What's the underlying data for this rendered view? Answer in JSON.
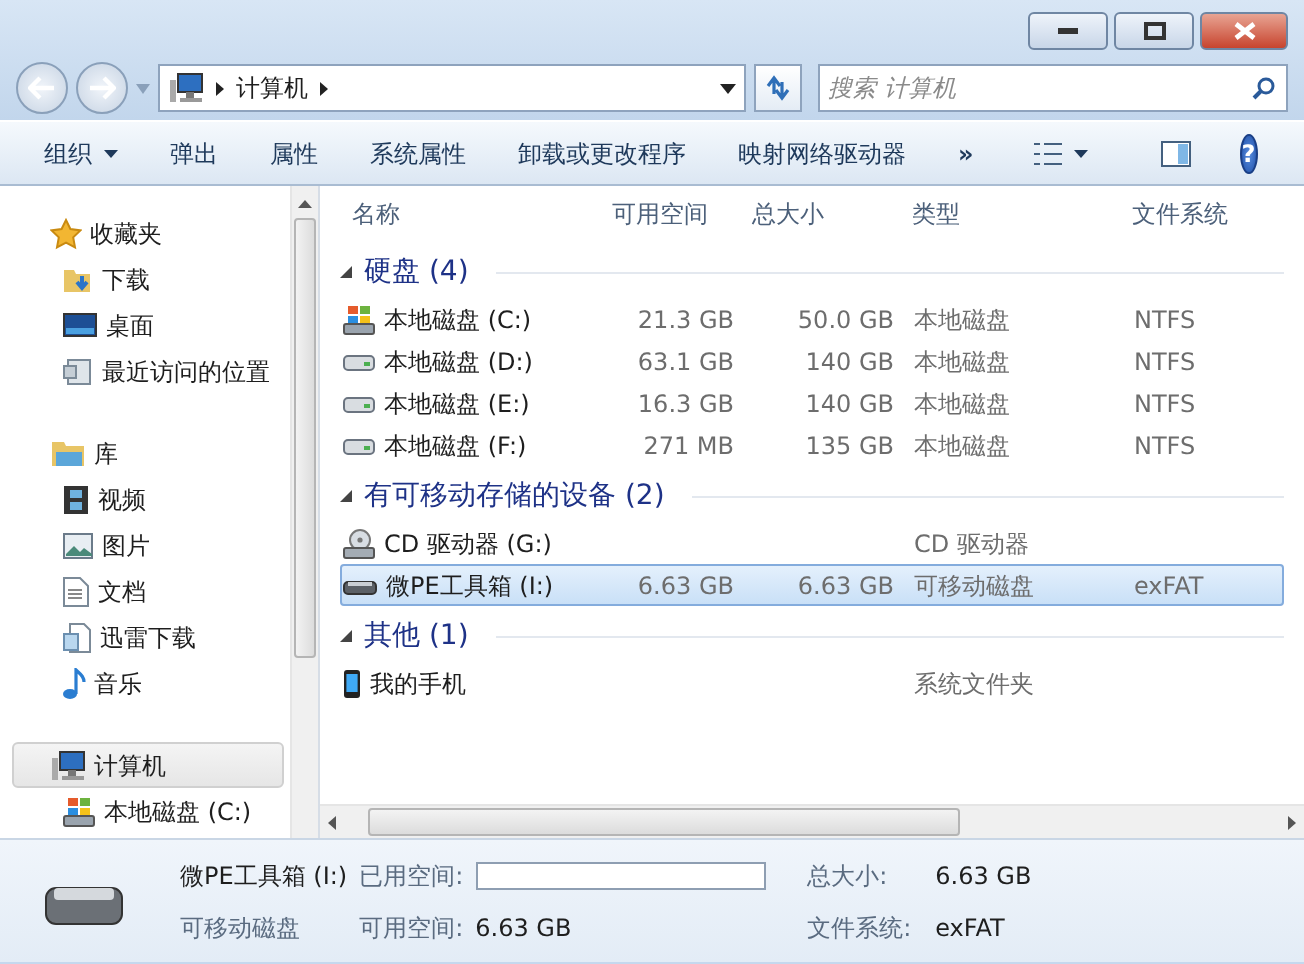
{
  "window": {
    "controls": [
      {
        "kind": "minimize"
      },
      {
        "kind": "maximize"
      },
      {
        "kind": "close"
      }
    ]
  },
  "address": {
    "path": [
      "计算机"
    ]
  },
  "search": {
    "placeholder": "搜索 计算机"
  },
  "toolbar": {
    "items": [
      {
        "label": "组织",
        "dropdown": true
      },
      {
        "label": "弹出",
        "dropdown": false
      },
      {
        "label": "属性",
        "dropdown": false
      },
      {
        "label": "系统属性",
        "dropdown": false
      },
      {
        "label": "卸载或更改程序",
        "dropdown": false
      },
      {
        "label": "映射网络驱动器",
        "dropdown": false
      }
    ],
    "more": "»",
    "help": "?"
  },
  "sidebar": {
    "groups": [
      {
        "label": "收藏夹",
        "kind": "star",
        "selected": false,
        "children": [
          {
            "label": "下载",
            "kind": "download"
          },
          {
            "label": "桌面",
            "kind": "desktop"
          },
          {
            "label": "最近访问的位置",
            "kind": "recent"
          }
        ]
      },
      {
        "label": "库",
        "kind": "library",
        "selected": false,
        "children": [
          {
            "label": "视频",
            "kind": "video"
          },
          {
            "label": "图片",
            "kind": "picture"
          },
          {
            "label": "文档",
            "kind": "document"
          },
          {
            "label": "迅雷下载",
            "kind": "thunder"
          },
          {
            "label": "音乐",
            "kind": "music"
          }
        ]
      },
      {
        "label": "计算机",
        "kind": "computer",
        "selected": true,
        "children": [
          {
            "label": "本地磁盘 (C:)",
            "kind": "system-drive"
          }
        ]
      }
    ]
  },
  "table": {
    "columns": [
      "名称",
      "可用空间",
      "总大小",
      "类型",
      "文件系统"
    ],
    "groups": [
      {
        "title": "硬盘 (4)",
        "expanded": true,
        "rows": [
          {
            "name": "本地磁盘 (C:)",
            "kind": "system-drive",
            "free": "21.3 GB",
            "total": "50.0 GB",
            "type": "本地磁盘",
            "fs": "NTFS",
            "selected": false
          },
          {
            "name": "本地磁盘 (D:)",
            "kind": "drive",
            "free": "63.1 GB",
            "total": "140 GB",
            "type": "本地磁盘",
            "fs": "NTFS",
            "selected": false
          },
          {
            "name": "本地磁盘 (E:)",
            "kind": "drive",
            "free": "16.3 GB",
            "total": "140 GB",
            "type": "本地磁盘",
            "fs": "NTFS",
            "selected": false
          },
          {
            "name": "本地磁盘 (F:)",
            "kind": "drive",
            "free": "271 MB",
            "total": "135 GB",
            "type": "本地磁盘",
            "fs": "NTFS",
            "selected": false
          }
        ]
      },
      {
        "title": "有可移动存储的设备 (2)",
        "expanded": true,
        "rows": [
          {
            "name": "CD 驱动器 (G:)",
            "kind": "cd",
            "type": "CD 驱动器",
            "selected": false
          },
          {
            "name": "微PE工具箱 (I:)",
            "kind": "usb",
            "free": "6.63 GB",
            "total": "6.63 GB",
            "type": "可移动磁盘",
            "fs": "exFAT",
            "selected": true
          }
        ]
      },
      {
        "title": "其他 (1)",
        "expanded": true,
        "rows": [
          {
            "name": "我的手机",
            "kind": "phone",
            "type": "系统文件夹",
            "selected": false
          }
        ]
      }
    ]
  },
  "details": {
    "name": "微PE工具箱 (I:)",
    "type": "可移动磁盘",
    "used_label": "已用空间:",
    "used_bar": {
      "level": 0
    },
    "free_label": "可用空间:",
    "free": "6.63 GB",
    "total_label": "总大小:",
    "total": "6.63 GB",
    "fs_label": "文件系统:",
    "fs": "exFAT"
  }
}
